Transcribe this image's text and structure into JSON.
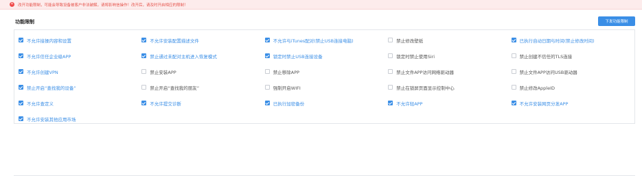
{
  "alert": {
    "text": "改开功能限制，可能会导致设备被客户非法破解，请将影响信操作！改开后，请及时开启相应的限制！"
  },
  "section": {
    "title": "功能限制",
    "button_label": "下发功能限制"
  },
  "colors": {
    "accent": "#3a8ee6",
    "alert_bg": "#fdecec",
    "alert_text": "#e5534b"
  },
  "restrictions": [
    {
      "label": "不允许接操内容和设置",
      "checked": true
    },
    {
      "label": "不允许安装配置描述文件",
      "checked": true
    },
    {
      "label": "不允许与iTunes配对(禁止USB连接电脑)",
      "checked": true
    },
    {
      "label": "禁止修改壁纸",
      "checked": false
    },
    {
      "label": "已执行自动日期与时间(禁止修改时间)",
      "checked": true
    },
    {
      "label": "不允许信任企业级APP",
      "checked": true
    },
    {
      "label": "禁止通过未配对主机进入恢复模式",
      "checked": true
    },
    {
      "label": "锁定时禁止USB连接设备",
      "checked": true
    },
    {
      "label": "锁定时禁止使用Siri",
      "checked": false
    },
    {
      "label": "禁止创建不信任的TLS连接",
      "checked": false
    },
    {
      "label": "不允许创建VPN",
      "checked": true
    },
    {
      "label": "禁止安装APP",
      "checked": false
    },
    {
      "label": "禁止移除APP",
      "checked": false
    },
    {
      "label": "禁止文件APP访问网络驱动器",
      "checked": false
    },
    {
      "label": "禁止文件APP访问USB驱动器",
      "checked": false
    },
    {
      "label": "禁止开启“查找我的设备”",
      "checked": true
    },
    {
      "label": "禁止开启“查找我的朋友”",
      "checked": false
    },
    {
      "label": "强制开启WIFI",
      "checked": false
    },
    {
      "label": "禁止在锁屏页面显示控制中心",
      "checked": false
    },
    {
      "label": "禁止修改AppleID",
      "checked": false
    },
    {
      "label": "不允许查定义",
      "checked": true
    },
    {
      "label": "不允许提交诊断",
      "checked": true
    },
    {
      "label": "已执行加密备份",
      "checked": true
    },
    {
      "label": "不允许轻APP",
      "checked": true
    },
    {
      "label": "不允许安装网页分发APP",
      "checked": true
    },
    {
      "label": "不允许安装其他应用市场",
      "checked": true
    }
  ]
}
